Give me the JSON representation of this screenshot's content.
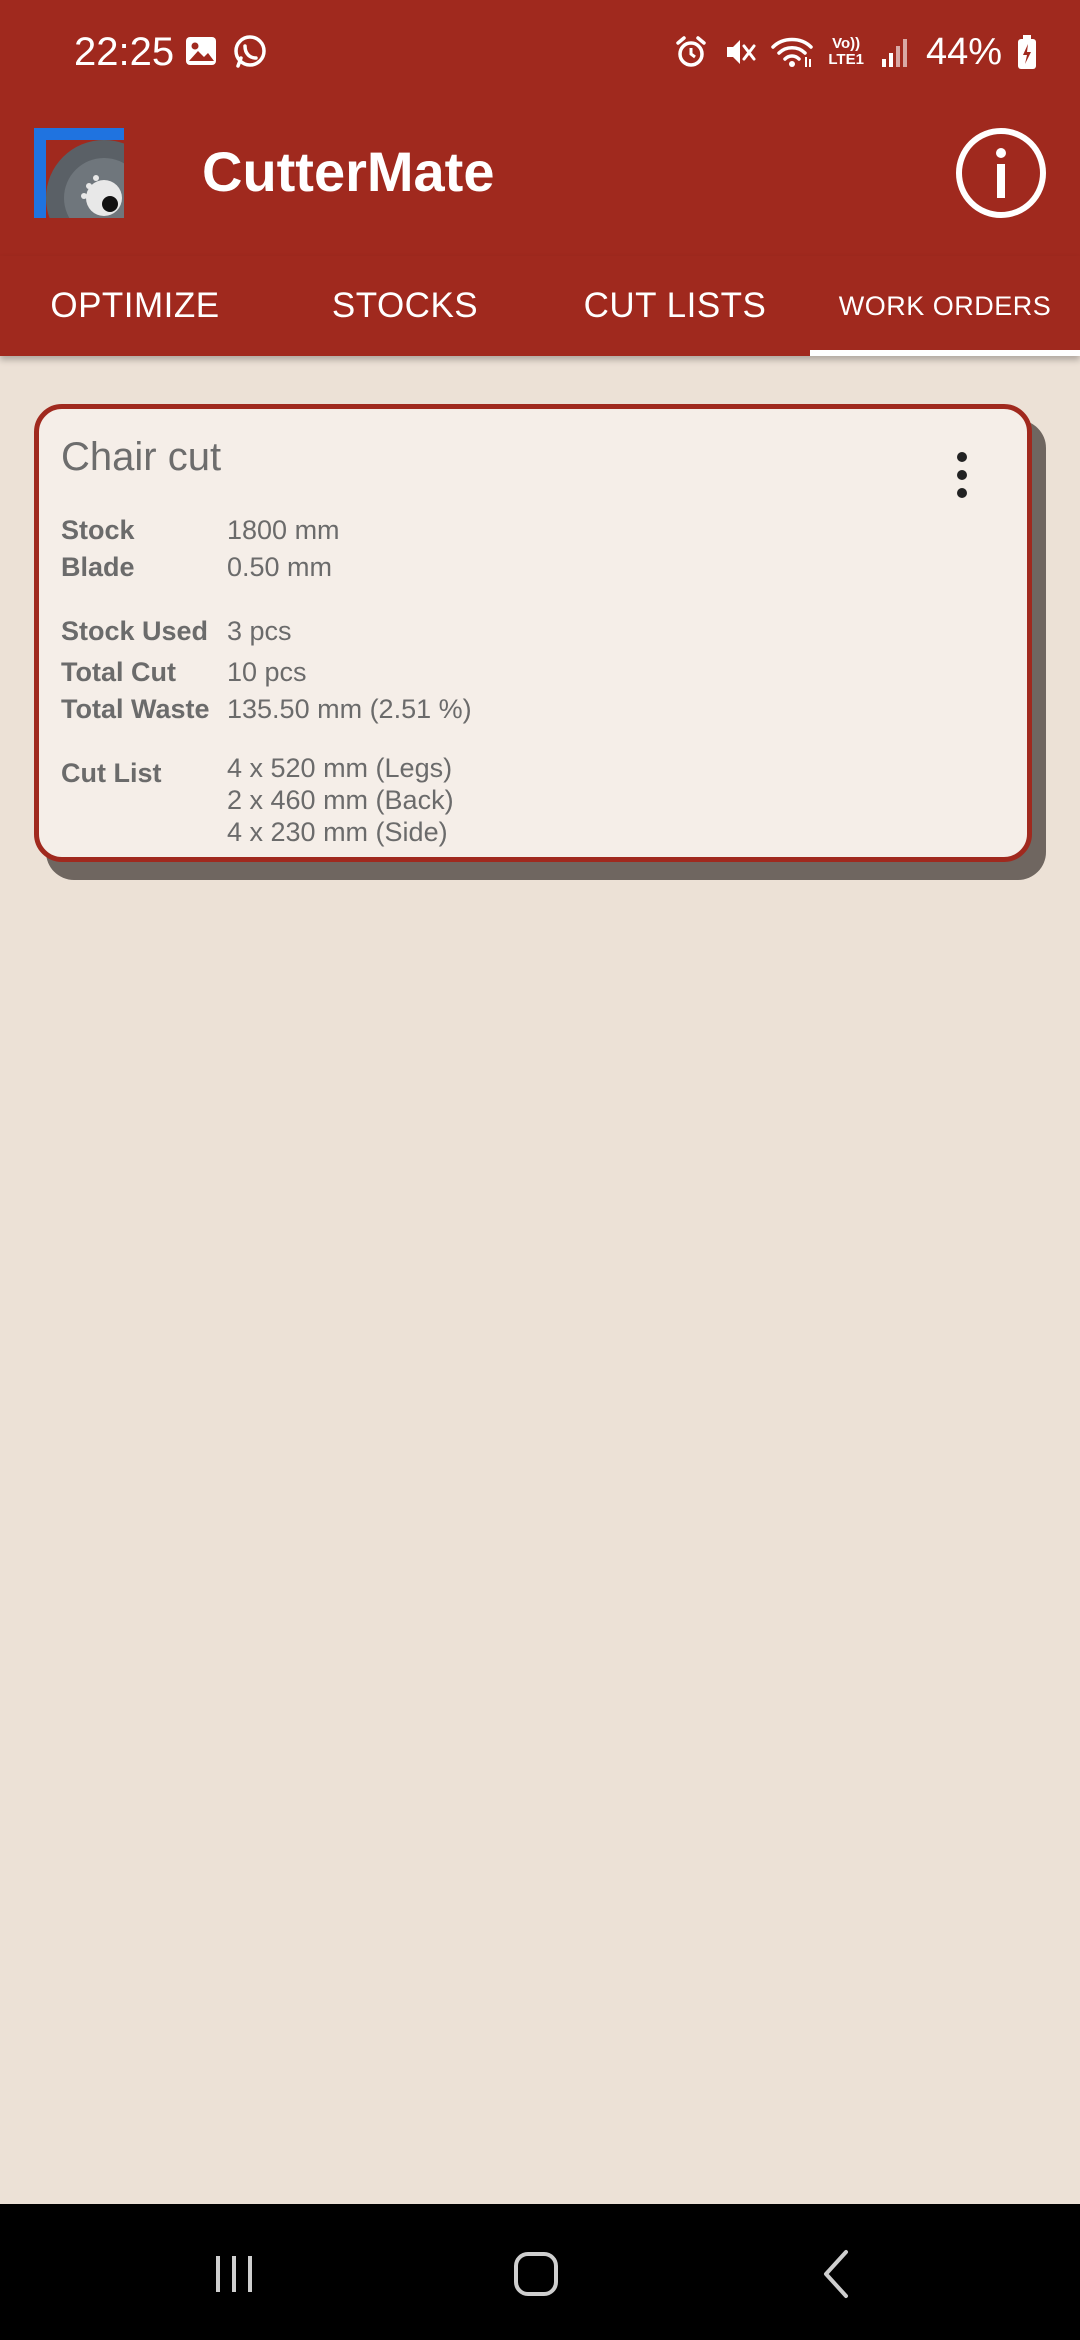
{
  "status_bar": {
    "time": "22:25",
    "battery": "44%",
    "left_icons": [
      "image-icon",
      "whatsapp-icon"
    ],
    "right_icons": [
      "alarm-icon",
      "mute-icon",
      "wifi-icon",
      "volte-icon",
      "signal-icon",
      "battery-icon"
    ],
    "volte_label": "Vo))",
    "lte_label": "LTE1"
  },
  "app_bar": {
    "title": "CutterMate",
    "logo_icon": "saw-blade-logo",
    "info_icon": "info-icon"
  },
  "tabs": [
    {
      "label": "OPTIMIZE",
      "selected": false
    },
    {
      "label": "STOCKS",
      "selected": false
    },
    {
      "label": "CUT LISTS",
      "selected": false
    },
    {
      "label": "WORK ORDERS",
      "selected": true
    }
  ],
  "work_orders": [
    {
      "title": "Chair cut",
      "menu_icon": "more-vert-icon",
      "stock_label": "Stock",
      "stock_value": "1800 mm",
      "blade_label": "Blade",
      "blade_value": "0.50 mm",
      "stock_used_label": "Stock Used",
      "stock_used_value": "3 pcs",
      "total_cut_label": "Total Cut",
      "total_cut_value": "10 pcs",
      "total_waste_label": "Total Waste",
      "total_waste_value": "135.50 mm (2.51 %)",
      "cut_list_label": "Cut List",
      "cut_list": [
        "4 x 520 mm (Legs)",
        "2 x 460 mm (Back)",
        "4 x 230 mm (Side)"
      ]
    }
  ],
  "nav_bar": {
    "icons": [
      "recents-icon",
      "home-icon",
      "back-icon"
    ]
  },
  "colors": {
    "primary": "#a0291e",
    "background": "#ece1d6",
    "card": "#f5eee8",
    "text": "#6b6b6b"
  }
}
